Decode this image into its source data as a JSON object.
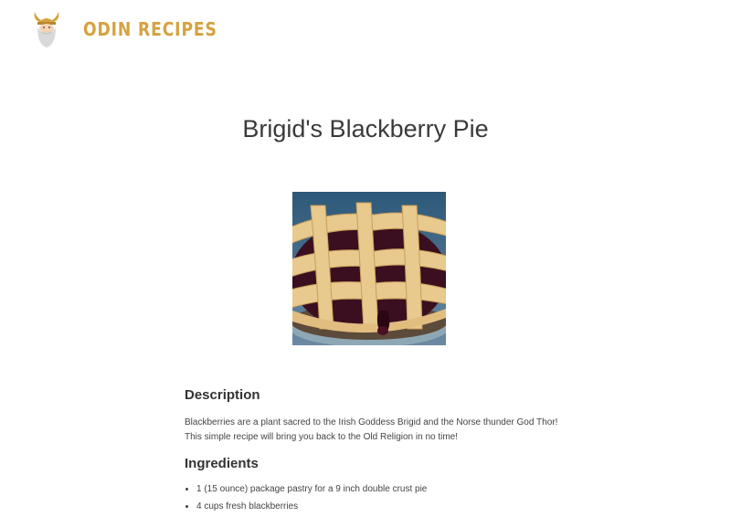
{
  "header": {
    "site_title": "ODIN RECIPES",
    "logo_icon": "viking-odin-logo-icon",
    "brand_color": "#d4a23f"
  },
  "recipe": {
    "title": "Brigid's Blackberry Pie",
    "image_icon": "blackberry-pie-photo",
    "description_heading": "Description",
    "description": "Blackberries are a plant sacred to the Irish Goddess Brigid and the Norse thunder God Thor! This simple recipe will bring you back to the Old Religion in no time!",
    "ingredients_heading": "Ingredients",
    "ingredients": [
      "1 (15 ounce) package pastry for a 9 inch double crust pie",
      "4 cups fresh blackberries"
    ]
  }
}
